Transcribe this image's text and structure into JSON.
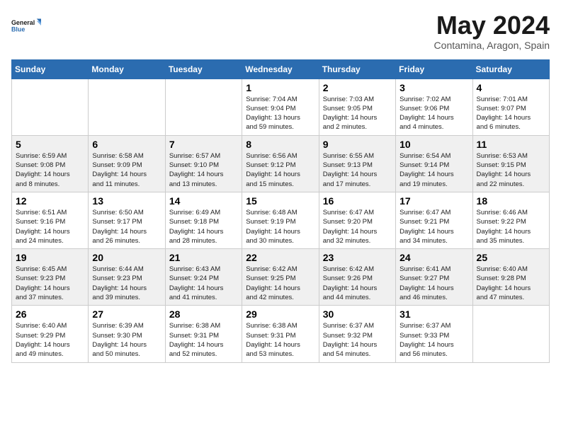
{
  "header": {
    "logo_line1": "General",
    "logo_line2": "Blue",
    "month": "May 2024",
    "location": "Contamina, Aragon, Spain"
  },
  "days_of_week": [
    "Sunday",
    "Monday",
    "Tuesday",
    "Wednesday",
    "Thursday",
    "Friday",
    "Saturday"
  ],
  "weeks": [
    [
      {
        "day": "",
        "empty": true
      },
      {
        "day": "",
        "empty": true
      },
      {
        "day": "",
        "empty": true
      },
      {
        "day": "1",
        "info": "Sunrise: 7:04 AM\nSunset: 9:04 PM\nDaylight: 13 hours\nand 59 minutes."
      },
      {
        "day": "2",
        "info": "Sunrise: 7:03 AM\nSunset: 9:05 PM\nDaylight: 14 hours\nand 2 minutes."
      },
      {
        "day": "3",
        "info": "Sunrise: 7:02 AM\nSunset: 9:06 PM\nDaylight: 14 hours\nand 4 minutes."
      },
      {
        "day": "4",
        "info": "Sunrise: 7:01 AM\nSunset: 9:07 PM\nDaylight: 14 hours\nand 6 minutes."
      }
    ],
    [
      {
        "day": "5",
        "info": "Sunrise: 6:59 AM\nSunset: 9:08 PM\nDaylight: 14 hours\nand 8 minutes."
      },
      {
        "day": "6",
        "info": "Sunrise: 6:58 AM\nSunset: 9:09 PM\nDaylight: 14 hours\nand 11 minutes."
      },
      {
        "day": "7",
        "info": "Sunrise: 6:57 AM\nSunset: 9:10 PM\nDaylight: 14 hours\nand 13 minutes."
      },
      {
        "day": "8",
        "info": "Sunrise: 6:56 AM\nSunset: 9:12 PM\nDaylight: 14 hours\nand 15 minutes."
      },
      {
        "day": "9",
        "info": "Sunrise: 6:55 AM\nSunset: 9:13 PM\nDaylight: 14 hours\nand 17 minutes."
      },
      {
        "day": "10",
        "info": "Sunrise: 6:54 AM\nSunset: 9:14 PM\nDaylight: 14 hours\nand 19 minutes."
      },
      {
        "day": "11",
        "info": "Sunrise: 6:53 AM\nSunset: 9:15 PM\nDaylight: 14 hours\nand 22 minutes."
      }
    ],
    [
      {
        "day": "12",
        "info": "Sunrise: 6:51 AM\nSunset: 9:16 PM\nDaylight: 14 hours\nand 24 minutes."
      },
      {
        "day": "13",
        "info": "Sunrise: 6:50 AM\nSunset: 9:17 PM\nDaylight: 14 hours\nand 26 minutes."
      },
      {
        "day": "14",
        "info": "Sunrise: 6:49 AM\nSunset: 9:18 PM\nDaylight: 14 hours\nand 28 minutes."
      },
      {
        "day": "15",
        "info": "Sunrise: 6:48 AM\nSunset: 9:19 PM\nDaylight: 14 hours\nand 30 minutes."
      },
      {
        "day": "16",
        "info": "Sunrise: 6:47 AM\nSunset: 9:20 PM\nDaylight: 14 hours\nand 32 minutes."
      },
      {
        "day": "17",
        "info": "Sunrise: 6:47 AM\nSunset: 9:21 PM\nDaylight: 14 hours\nand 34 minutes."
      },
      {
        "day": "18",
        "info": "Sunrise: 6:46 AM\nSunset: 9:22 PM\nDaylight: 14 hours\nand 35 minutes."
      }
    ],
    [
      {
        "day": "19",
        "info": "Sunrise: 6:45 AM\nSunset: 9:23 PM\nDaylight: 14 hours\nand 37 minutes."
      },
      {
        "day": "20",
        "info": "Sunrise: 6:44 AM\nSunset: 9:23 PM\nDaylight: 14 hours\nand 39 minutes."
      },
      {
        "day": "21",
        "info": "Sunrise: 6:43 AM\nSunset: 9:24 PM\nDaylight: 14 hours\nand 41 minutes."
      },
      {
        "day": "22",
        "info": "Sunrise: 6:42 AM\nSunset: 9:25 PM\nDaylight: 14 hours\nand 42 minutes."
      },
      {
        "day": "23",
        "info": "Sunrise: 6:42 AM\nSunset: 9:26 PM\nDaylight: 14 hours\nand 44 minutes."
      },
      {
        "day": "24",
        "info": "Sunrise: 6:41 AM\nSunset: 9:27 PM\nDaylight: 14 hours\nand 46 minutes."
      },
      {
        "day": "25",
        "info": "Sunrise: 6:40 AM\nSunset: 9:28 PM\nDaylight: 14 hours\nand 47 minutes."
      }
    ],
    [
      {
        "day": "26",
        "info": "Sunrise: 6:40 AM\nSunset: 9:29 PM\nDaylight: 14 hours\nand 49 minutes."
      },
      {
        "day": "27",
        "info": "Sunrise: 6:39 AM\nSunset: 9:30 PM\nDaylight: 14 hours\nand 50 minutes."
      },
      {
        "day": "28",
        "info": "Sunrise: 6:38 AM\nSunset: 9:31 PM\nDaylight: 14 hours\nand 52 minutes."
      },
      {
        "day": "29",
        "info": "Sunrise: 6:38 AM\nSunset: 9:31 PM\nDaylight: 14 hours\nand 53 minutes."
      },
      {
        "day": "30",
        "info": "Sunrise: 6:37 AM\nSunset: 9:32 PM\nDaylight: 14 hours\nand 54 minutes."
      },
      {
        "day": "31",
        "info": "Sunrise: 6:37 AM\nSunset: 9:33 PM\nDaylight: 14 hours\nand 56 minutes."
      },
      {
        "day": "",
        "empty": true
      }
    ]
  ]
}
